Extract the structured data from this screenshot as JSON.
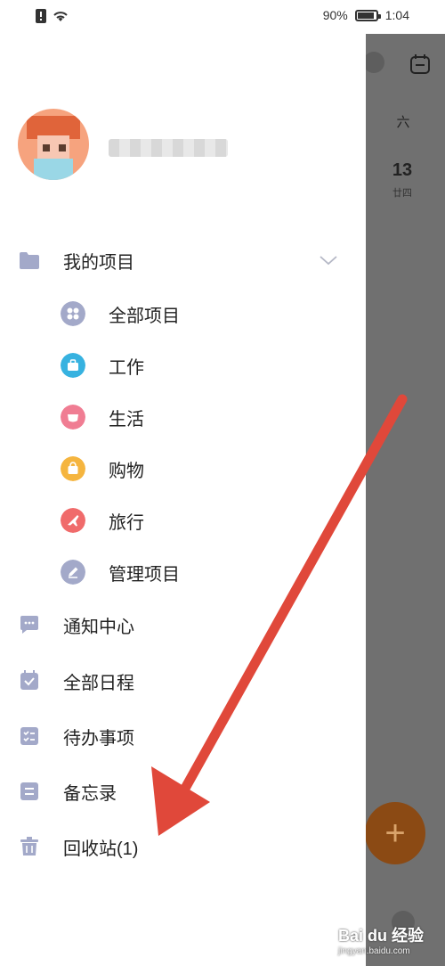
{
  "status_bar": {
    "battery": "90%",
    "battery_level": 0.9,
    "time": "1:04"
  },
  "calendar": {
    "weekday": "六",
    "day": "13",
    "lunar": "廿四"
  },
  "drawer": {
    "projects_header": "我的项目",
    "project_items": [
      {
        "label": "全部项目",
        "icon": "grid-icon",
        "color": "#a3a9c9"
      },
      {
        "label": "工作",
        "icon": "briefcase-icon",
        "color": "#37b2e0"
      },
      {
        "label": "生活",
        "icon": "cup-icon",
        "color": "#f07d93"
      },
      {
        "label": "购物",
        "icon": "shopping-bag-icon",
        "color": "#f5b53f"
      },
      {
        "label": "旅行",
        "icon": "airplane-icon",
        "color": "#f06b6b"
      },
      {
        "label": "管理项目",
        "icon": "pencil-icon",
        "color": "#a3a9c9"
      }
    ],
    "menu_items": [
      {
        "label": "通知中心",
        "icon": "message-icon"
      },
      {
        "label": "全部日程",
        "icon": "calendar-check-icon"
      },
      {
        "label": "待办事项",
        "icon": "todo-list-icon"
      },
      {
        "label": "备忘录",
        "icon": "memo-icon"
      },
      {
        "label": "回收站(1)",
        "icon": "trash-icon"
      }
    ]
  },
  "fab": {
    "label": "+"
  },
  "watermark": {
    "text": "Bai du 经验",
    "sub": "jingyan.baidu.com"
  },
  "colors": {
    "icon_grey": "#a3a9c9",
    "backdrop": "#707070",
    "arrow": "#e0483a"
  }
}
